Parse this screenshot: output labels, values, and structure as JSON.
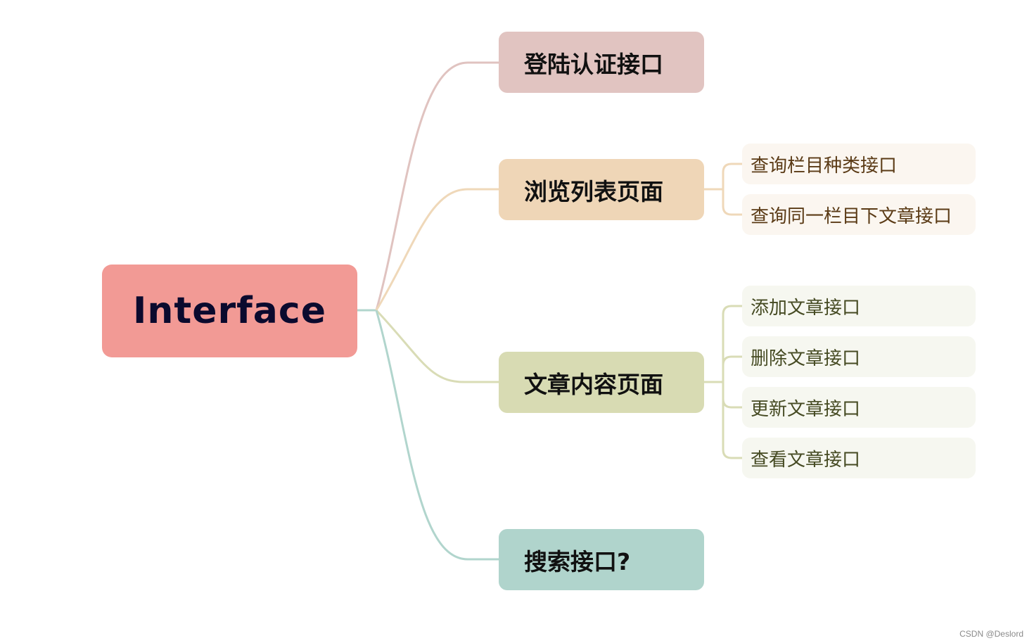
{
  "diagram": {
    "type": "mind-map",
    "root": {
      "label": "Interface",
      "color": "#f29a95",
      "text_color": "#0b0a2e"
    },
    "branches": [
      {
        "label": "登陆认证接口",
        "color": "#e1c4c1",
        "line_color": "#e0c3c0",
        "children": []
      },
      {
        "label": "浏览列表页面",
        "color": "#efd6b7",
        "line_color": "#efd8b9",
        "leaf_bg": "#fbf6f0",
        "leaf_text_color": "#5a3a15",
        "children": [
          {
            "label": "查询栏目种类接口"
          },
          {
            "label": "查询同一栏目下文章接口"
          }
        ]
      },
      {
        "label": "文章内容页面",
        "color": "#d8dbb3",
        "line_color": "#d9dcb6",
        "leaf_bg": "#f6f7f0",
        "leaf_text_color": "#454a22",
        "children": [
          {
            "label": "添加文章接口"
          },
          {
            "label": "删除文章接口"
          },
          {
            "label": "更新文章接口"
          },
          {
            "label": "查看文章接口"
          }
        ]
      },
      {
        "label": "搜索接口?",
        "color": "#b0d4cc",
        "line_color": "#b1d5cd",
        "children": []
      }
    ]
  },
  "watermark": "CSDN @Deslord"
}
